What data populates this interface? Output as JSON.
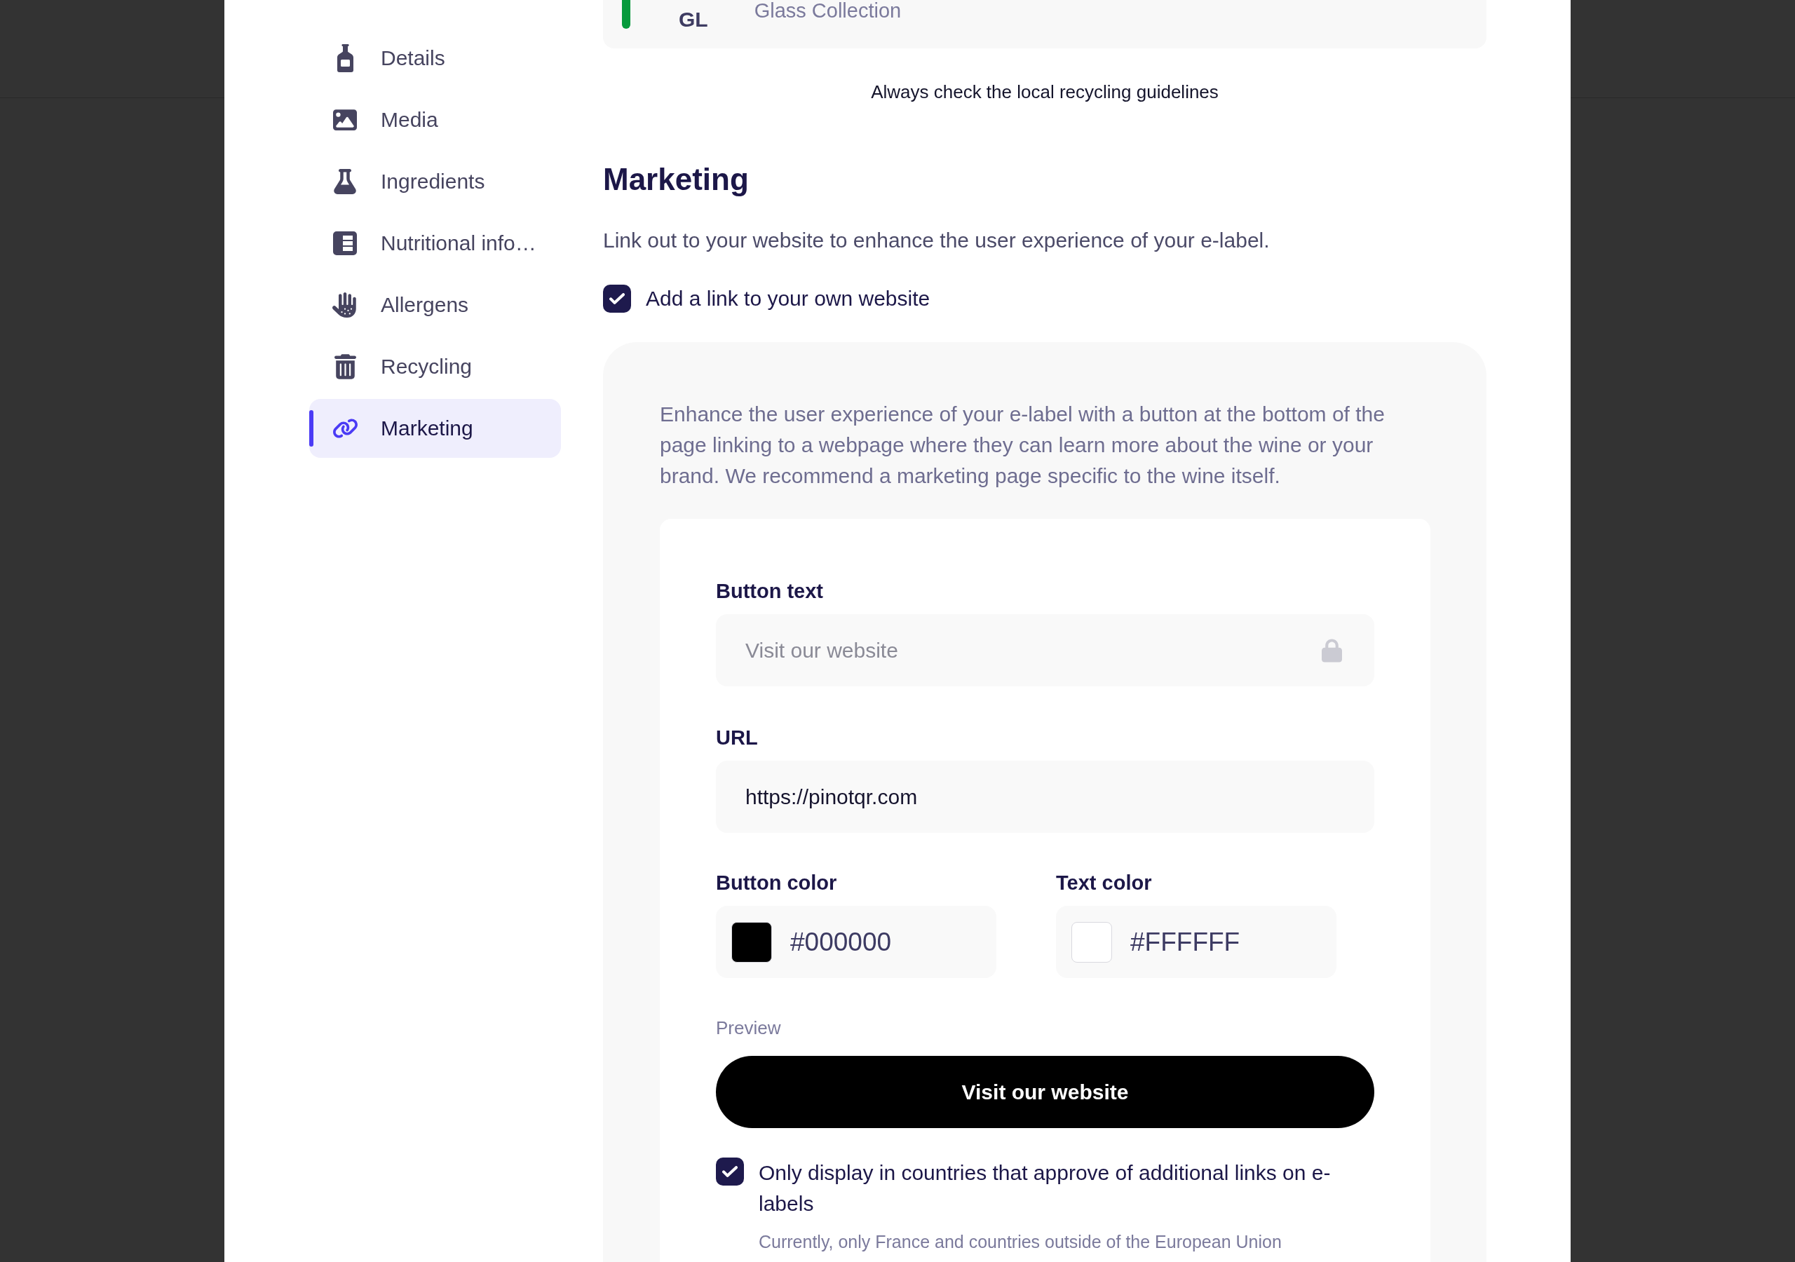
{
  "sidebar": {
    "items": [
      {
        "label": "Details",
        "selected": false
      },
      {
        "label": "Media",
        "selected": false
      },
      {
        "label": "Ingredients",
        "selected": false
      },
      {
        "label": "Nutritional info…",
        "selected": false
      },
      {
        "label": "Allergens",
        "selected": false
      },
      {
        "label": "Recycling",
        "selected": false
      },
      {
        "label": "Marketing",
        "selected": true
      }
    ]
  },
  "recycling": {
    "materials": [
      {
        "code": "GL",
        "name": "Glass Collection",
        "color": "#079a3c"
      }
    ],
    "note": "Always check the local recycling guidelines"
  },
  "marketing": {
    "title": "Marketing",
    "description": "Link out to your website to enhance the user experience of your e-label.",
    "add_link": {
      "label": "Add a link to your own website",
      "checked": true
    },
    "panel": {
      "intro": "Enhance the user experience of your e-label with a button at the bottom of the page linking to a webpage where they can learn more about the wine or your brand. We recommend a marketing page specific to the wine itself.",
      "fields": [
        {
          "label": "Button text",
          "value": "Visit our website",
          "disabled": true
        },
        {
          "label": "URL",
          "value": "https://pinotqr.com",
          "disabled": false
        }
      ],
      "colors": [
        {
          "label": "Button color",
          "value": "#000000"
        },
        {
          "label": "Text color",
          "value": "#FFFFFF"
        }
      ],
      "preview": {
        "label": "Preview",
        "button": "Visit our website"
      },
      "country_limit": {
        "label": "Only display in countries that approve of additional links on e-labels",
        "checked": true,
        "note": "Currently, only France and countries outside of the European Union"
      }
    }
  }
}
